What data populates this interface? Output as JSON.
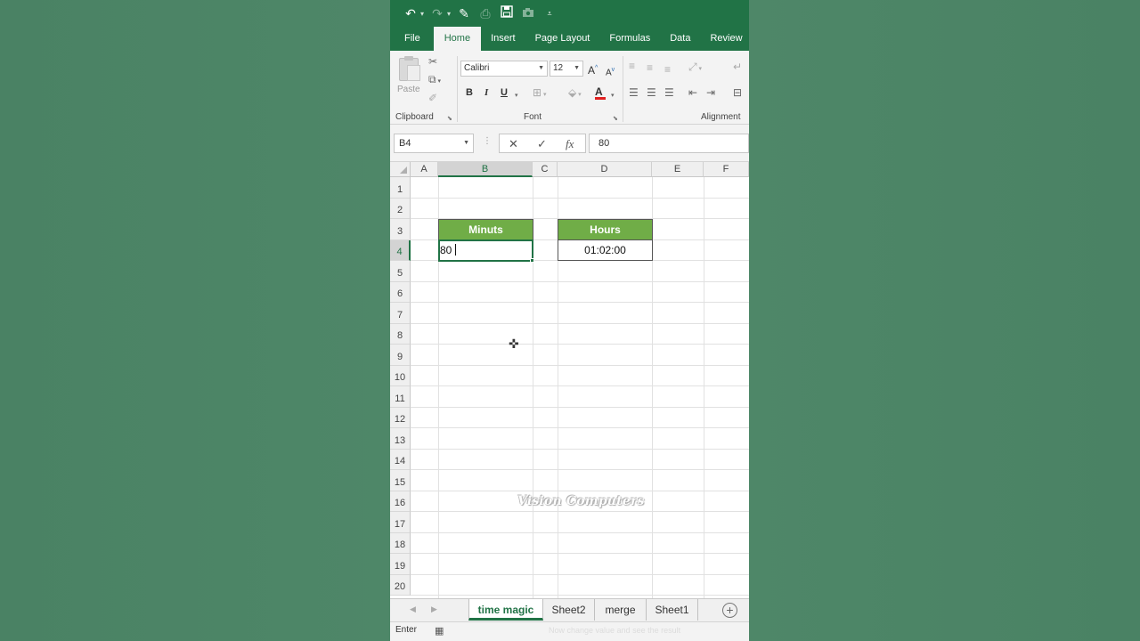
{
  "qat": {
    "icons": [
      "undo-icon",
      "redo-icon",
      "eraser-icon",
      "print-preview-icon",
      "save-icon",
      "camera-icon",
      "customize-icon"
    ]
  },
  "tabs": [
    "File",
    "Home",
    "Insert",
    "Page Layout",
    "Formulas",
    "Data",
    "Review"
  ],
  "active_tab": "Home",
  "ribbon": {
    "clipboard_label": "Clipboard",
    "paste_label": "Paste",
    "font_label": "Font",
    "alignment_label": "Alignment",
    "font_name": "Calibri",
    "font_size": "12",
    "bold": "B",
    "italic": "I",
    "underline": "U",
    "grow_font": "A",
    "shrink_font": "A",
    "font_color_glyph": "A",
    "font_color": "#e02020"
  },
  "formula_bar": {
    "name_box": "B4",
    "cancel": "✕",
    "enter": "✓",
    "fx": "fx",
    "formula": "80"
  },
  "columns": [
    "A",
    "B",
    "C",
    "D",
    "E",
    "F"
  ],
  "selected_column": "B",
  "rows": [
    "1",
    "2",
    "3",
    "4",
    "5",
    "6",
    "7",
    "8",
    "9",
    "10",
    "11",
    "12",
    "13",
    "14",
    "15",
    "16",
    "17",
    "18",
    "19",
    "20"
  ],
  "selected_row": "4",
  "cells": {
    "B3": "Minuts",
    "D3": "Hours",
    "B4": "80",
    "D4": "01:02:00"
  },
  "header_fill": "#70ad47",
  "accent": "#217346",
  "watermark": "Vision Computers",
  "sheets": [
    "time magic",
    "Sheet2",
    "merge",
    "Sheet1"
  ],
  "active_sheet": "time magic",
  "status": {
    "mode": "Enter",
    "caption": "Now change value and see the result"
  }
}
